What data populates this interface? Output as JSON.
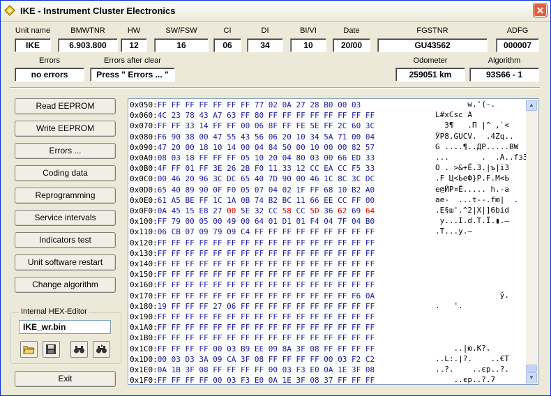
{
  "window": {
    "title": "IKE - Instrument Cluster Electronics",
    "close_glyph": "✕"
  },
  "info": {
    "labels": {
      "unit_name": "Unit name",
      "bmwtnr": "BMWTNR",
      "hw": "HW",
      "sw_fsw": "SW/FSW",
      "ci": "CI",
      "di": "DI",
      "bi_vi": "BI/VI",
      "date": "Date",
      "fgstnr": "FGSTNR",
      "adfg": "ADFG",
      "errors": "Errors",
      "errors_after_clear": "Errors after clear",
      "odometer": "Odometer",
      "algorithm": "Algorithm"
    },
    "values": {
      "unit_name": "IKE",
      "bmwtnr": "6.903.800",
      "hw": "12",
      "sw_fsw": "16",
      "ci": "06",
      "di": "34",
      "bi_vi": "10",
      "date": "20/00",
      "fgstnr": "GU43562",
      "adfg": "000007",
      "errors": "no errors",
      "errors_after_clear": "Press \" Errors ... \"",
      "odometer": "259051 km",
      "algorithm": "93S66 - 1"
    }
  },
  "buttons": {
    "read_eeprom": "Read EEPROM",
    "write_eeprom": "Write EEPROM",
    "errors": "Errors ...",
    "coding_data": "Coding data",
    "reprogramming": "Reprogramming",
    "service_intervals": "Service intervals",
    "indicators_test": "Indicators test",
    "unit_software_restart": "Unit software restart",
    "change_algorithm": "Change algorithm",
    "exit": "Exit"
  },
  "hex_editor": {
    "group_title": "Internal HEX-Editor",
    "filename": "IKE_wr.bin",
    "tools": [
      "open-folder-icon",
      "save-disk-icon",
      "find-binoculars-icon",
      "find-next-binoculars-icon"
    ]
  },
  "colors": {
    "hex_byte": "#1a1aa0",
    "highlight_byte": "#e00000"
  },
  "hex_rows": [
    {
      "addr": "0x050:",
      "bytes": [
        "FF",
        "FF",
        "FF",
        "FF",
        "FF",
        "FF",
        "FF",
        "77",
        "02",
        "0A",
        "27",
        "28",
        "B0",
        "00",
        "03"
      ],
      "red": [],
      "ascii": "       w.'(-."
    },
    {
      "addr": "0x060:",
      "bytes": [
        "4C",
        "23",
        "78",
        "43",
        "A7",
        "63",
        "FF",
        "80",
        "FF",
        "FF",
        "FF",
        "FF",
        "FF",
        "FF",
        "FF",
        "FF"
      ],
      "red": [],
      "ascii": "L#xCsc A"
    },
    {
      "addr": "0x070:",
      "bytes": [
        "FF",
        "FF",
        "33",
        "14",
        "FF",
        "FF",
        "00",
        "06",
        "8F",
        "FF",
        "FE",
        "5E",
        "FF",
        "2C",
        "60",
        "3C"
      ],
      "red": [],
      "ascii": "  3¶   .П |^ ,`<"
    },
    {
      "addr": "0x080:",
      "bytes": [
        "F6",
        "90",
        "38",
        "00",
        "47",
        "55",
        "43",
        "56",
        "06",
        "20",
        "10",
        "34",
        "5A",
        "71",
        "00",
        "04"
      ],
      "red": [],
      "ascii": "ЎР8.GUCV.  .4Zq.."
    },
    {
      "addr": "0x090:",
      "bytes": [
        "47",
        "20",
        "00",
        "18",
        "10",
        "14",
        "00",
        "04",
        "84",
        "50",
        "00",
        "10",
        "00",
        "00",
        "82",
        "57"
      ],
      "red": [],
      "ascii": "G ....¶..ДР.....BW"
    },
    {
      "addr": "0x0A0:",
      "bytes": [
        "08",
        "03",
        "18",
        "FF",
        "FF",
        "FF",
        "05",
        "10",
        "20",
        "04",
        "80",
        "03",
        "00",
        "66",
        "ED",
        "33"
      ],
      "red": [],
      "ascii": "...       .  .A..fз3"
    },
    {
      "addr": "0x0B0:",
      "bytes": [
        "4F",
        "FF",
        "01",
        "FF",
        "3E",
        "26",
        "2B",
        "F0",
        "11",
        "33",
        "12",
        "CC",
        "EA",
        "CC",
        "F5",
        "33"
      ],
      "red": [],
      "ascii": "O . >&+Ё.3.|ъ|і3"
    },
    {
      "addr": "0x0C0:",
      "bytes": [
        "00",
        "46",
        "20",
        "96",
        "3C",
        "DC",
        "65",
        "40",
        "7D",
        "90",
        "00",
        "46",
        "1C",
        "8C",
        "3C",
        "DC"
      ],
      "red": [],
      "ascii": ".F Ц<ЬeФ}Р.F.М<Ь"
    },
    {
      "addr": "0x0D0:",
      "bytes": [
        "65",
        "40",
        "89",
        "90",
        "0F",
        "F0",
        "05",
        "07",
        "04",
        "02",
        "1F",
        "FF",
        "68",
        "10",
        "B2",
        "A0"
      ],
      "red": [],
      "ascii": "e@ЙР¤Ё..... h.-a"
    },
    {
      "addr": "0x0E0:",
      "bytes": [
        "61",
        "A5",
        "BE",
        "FF",
        "1C",
        "1A",
        "0B",
        "74",
        "B2",
        "BC",
        "11",
        "66",
        "EE",
        "CC",
        "FF",
        "00"
      ],
      "red": [],
      "ascii": "ae-  ...t--.fю|  ."
    },
    {
      "addr": "0x0F0:",
      "bytes": [
        "0A",
        "45",
        "15",
        "E8",
        "27",
        "00",
        "5E",
        "32",
        "CC",
        "58",
        "CC",
        "5D",
        "36",
        "62",
        "69",
        "64"
      ],
      "red": [
        5,
        9,
        11,
        13,
        15
      ],
      "ascii": ".E§ш'.^2|X|]6bid"
    },
    {
      "addr": "0x100:",
      "bytes": [
        "FF",
        "79",
        "00",
        "05",
        "00",
        "49",
        "00",
        "64",
        "01",
        "D1",
        "01",
        "F4",
        "04",
        "7F",
        "04",
        "B0"
      ],
      "red": [],
      "ascii": " y...I.d.T.Ї.▮.–"
    },
    {
      "addr": "0x110:",
      "bytes": [
        "06",
        "CB",
        "07",
        "09",
        "79",
        "09",
        "C4",
        "FF",
        "FF",
        "FF",
        "FF",
        "FF",
        "FF",
        "FF",
        "FF",
        "FF"
      ],
      "red": [],
      "ascii": ".T...y.–"
    },
    {
      "addr": "0x120:",
      "bytes": [
        "FF",
        "FF",
        "FF",
        "FF",
        "FF",
        "FF",
        "FF",
        "FF",
        "FF",
        "FF",
        "FF",
        "FF",
        "FF",
        "FF",
        "FF",
        "FF"
      ],
      "red": [],
      "ascii": ""
    },
    {
      "addr": "0x130:",
      "bytes": [
        "FF",
        "FF",
        "FF",
        "FF",
        "FF",
        "FF",
        "FF",
        "FF",
        "FF",
        "FF",
        "FF",
        "FF",
        "FF",
        "FF",
        "FF",
        "FF"
      ],
      "red": [],
      "ascii": ""
    },
    {
      "addr": "0x140:",
      "bytes": [
        "FF",
        "FF",
        "FF",
        "FF",
        "FF",
        "FF",
        "FF",
        "FF",
        "FF",
        "FF",
        "FF",
        "FF",
        "FF",
        "FF",
        "FF",
        "FF"
      ],
      "red": [],
      "ascii": ""
    },
    {
      "addr": "0x150:",
      "bytes": [
        "FF",
        "FF",
        "FF",
        "FF",
        "FF",
        "FF",
        "FF",
        "FF",
        "FF",
        "FF",
        "FF",
        "FF",
        "FF",
        "FF",
        "FF",
        "FF"
      ],
      "red": [],
      "ascii": ""
    },
    {
      "addr": "0x160:",
      "bytes": [
        "FF",
        "FF",
        "FF",
        "FF",
        "FF",
        "FF",
        "FF",
        "FF",
        "FF",
        "FF",
        "FF",
        "FF",
        "FF",
        "FF",
        "FF",
        "FF"
      ],
      "red": [],
      "ascii": ""
    },
    {
      "addr": "0x170:",
      "bytes": [
        "FF",
        "FF",
        "FF",
        "FF",
        "FF",
        "FF",
        "FF",
        "FF",
        "FF",
        "FF",
        "FF",
        "FF",
        "FF",
        "FF",
        "F6",
        "0A"
      ],
      "red": [],
      "ascii": "              ў."
    },
    {
      "addr": "0x180:",
      "bytes": [
        "19",
        "FF",
        "FF",
        "FF",
        "27",
        "06",
        "FF",
        "FF",
        "FF",
        "FF",
        "FF",
        "FF",
        "FF",
        "FF",
        "FF",
        "FF"
      ],
      "red": [],
      "ascii": ".   '."
    },
    {
      "addr": "0x190:",
      "bytes": [
        "FF",
        "FF",
        "FF",
        "FF",
        "FF",
        "FF",
        "FF",
        "FF",
        "FF",
        "FF",
        "FF",
        "FF",
        "FF",
        "FF",
        "FF",
        "FF"
      ],
      "red": [],
      "ascii": ""
    },
    {
      "addr": "0x1A0:",
      "bytes": [
        "FF",
        "FF",
        "FF",
        "FF",
        "FF",
        "FF",
        "FF",
        "FF",
        "FF",
        "FF",
        "FF",
        "FF",
        "FF",
        "FF",
        "FF",
        "FF"
      ],
      "red": [],
      "ascii": ""
    },
    {
      "addr": "0x1B0:",
      "bytes": [
        "FF",
        "FF",
        "FF",
        "FF",
        "FF",
        "FF",
        "FF",
        "FF",
        "FF",
        "FF",
        "FF",
        "FF",
        "FF",
        "FF",
        "FF",
        "FF"
      ],
      "red": [],
      "ascii": ""
    },
    {
      "addr": "0x1C0:",
      "bytes": [
        "FF",
        "FF",
        "FF",
        "FF",
        "00",
        "03",
        "B9",
        "EE",
        "09",
        "8A",
        "3F",
        "08",
        "FF",
        "FF",
        "FF",
        "FF"
      ],
      "red": [],
      "ascii": "    ..|ю.К?."
    },
    {
      "addr": "0x1D0:",
      "bytes": [
        "00",
        "03",
        "D3",
        "3A",
        "09",
        "CA",
        "3F",
        "08",
        "FF",
        "FF",
        "FF",
        "FF",
        "00",
        "03",
        "F2",
        "C2"
      ],
      "red": [],
      "ascii": "..L:.|?.    ..€T"
    },
    {
      "addr": "0x1E0:",
      "bytes": [
        "0A",
        "1B",
        "3F",
        "08",
        "FF",
        "FF",
        "FF",
        "FF",
        "00",
        "03",
        "F3",
        "E0",
        "0A",
        "1E",
        "3F",
        "08"
      ],
      "red": [],
      "ascii": "..?.    ..єр..?."
    },
    {
      "addr": "0x1F0:",
      "bytes": [
        "FF",
        "FF",
        "FF",
        "FF",
        "00",
        "03",
        "F3",
        "E0",
        "0A",
        "1E",
        "3F",
        "08",
        "37",
        "FF",
        "FF",
        "FF"
      ],
      "red": [],
      "ascii": "    ..єр..?.7"
    }
  ]
}
